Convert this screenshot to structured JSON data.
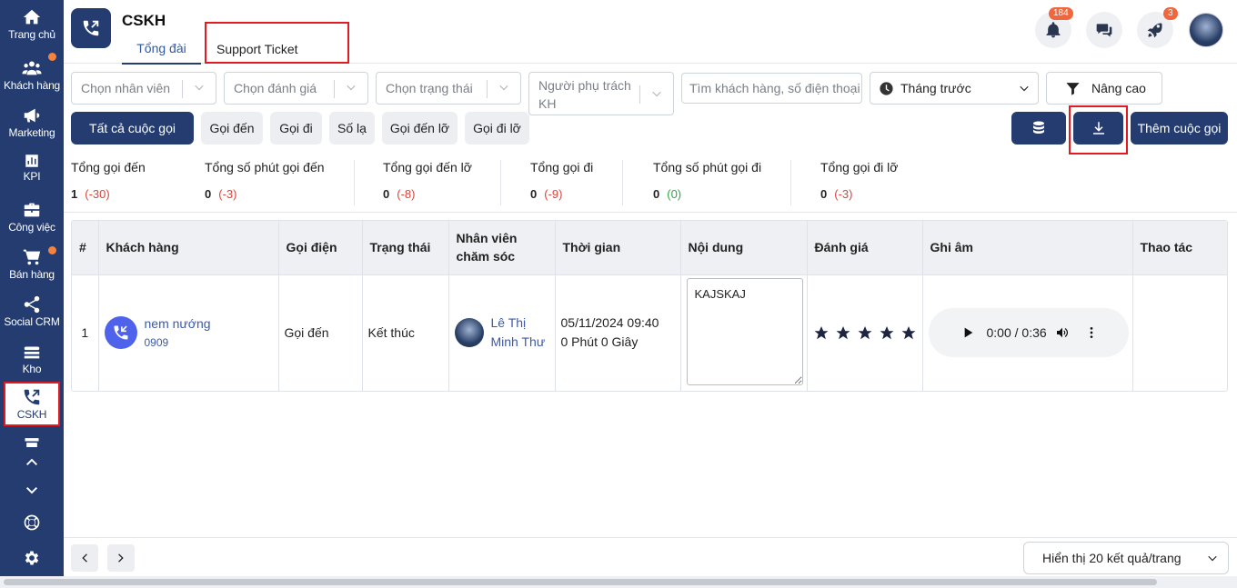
{
  "sidebar": {
    "items": [
      {
        "label": "Trang chủ",
        "icon": "home-icon"
      },
      {
        "label": "Khách hàng",
        "icon": "users-icon"
      },
      {
        "label": "Marketing",
        "icon": "megaphone-icon"
      },
      {
        "label": "KPI",
        "icon": "chart-icon"
      },
      {
        "label": "Công việc",
        "icon": "briefcase-icon"
      },
      {
        "label": "Bán hàng",
        "icon": "cart-icon"
      },
      {
        "label": "Social CRM",
        "icon": "share-icon"
      },
      {
        "label": "Kho",
        "icon": "stack-icon"
      },
      {
        "label": "CSKH",
        "icon": "phone-forward-icon"
      }
    ]
  },
  "header": {
    "title": "CSKH",
    "tabs": [
      {
        "label": "Tổng đài"
      },
      {
        "label": "Support Ticket"
      }
    ],
    "notifications_count": "184",
    "rocket_count": "3"
  },
  "filters": {
    "staff": "Chọn nhân viên",
    "rating": "Chọn đánh giá",
    "status": "Chọn trạng thái",
    "owner": "Người phụ trách KH",
    "search_placeholder": "Tìm khách hàng, số điện thoại",
    "period": "Tháng trước",
    "advanced": "Nâng cao"
  },
  "call_types": [
    "Tất cả cuộc gọi",
    "Gọi đến",
    "Gọi đi",
    "Số lạ",
    "Gọi đến lỡ",
    "Gọi đi lỡ"
  ],
  "actions": {
    "add_call": "Thêm cuộc gọi"
  },
  "stats": [
    {
      "label": "Tổng gọi đến",
      "value": "1",
      "delta": "(-30)"
    },
    {
      "label": "Tổng số phút gọi đến",
      "value": "0",
      "delta": "(-3)"
    },
    {
      "label": "Tổng gọi đến lỡ",
      "value": "0",
      "delta": "(-8)"
    },
    {
      "label": "Tổng gọi đi",
      "value": "0",
      "delta": "(-9)"
    },
    {
      "label": "Tổng số phút gọi đi",
      "value": "0",
      "delta": "(0)"
    },
    {
      "label": "Tổng gọi đi lỡ",
      "value": "0",
      "delta": "(-3)"
    }
  ],
  "table": {
    "columns": [
      "#",
      "Khách hàng",
      "Gọi điện",
      "Trạng thái",
      "Nhân viên chăm sóc",
      "Thời gian",
      "Nội dung",
      "Đánh giá",
      "Ghi âm",
      "Thao tác"
    ],
    "rows": [
      {
        "index": "1",
        "customer_name": "nem nướng",
        "customer_phone": "0909",
        "call_type": "Gọi đến",
        "status": "Kết thúc",
        "staff": "Lê Thị Minh Thư",
        "time": "05/11/2024 09:40",
        "duration": "0 Phút 0 Giây",
        "note": "KAJSKAJ",
        "rating": 5,
        "recording_time": "0:00 / 0:36"
      }
    ]
  },
  "footer": {
    "per_page": "Hiển thị 20 kết quả/trang"
  }
}
